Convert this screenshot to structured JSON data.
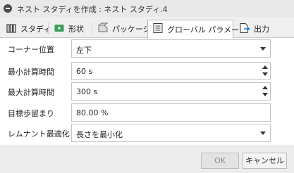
{
  "window": {
    "title": "ネスト スタディを作成 : ネスト スタディ.4"
  },
  "tabs": [
    {
      "label": "スタディ",
      "icon": "study-icon",
      "active": false
    },
    {
      "label": "形状",
      "icon": "shape-icon",
      "active": false
    },
    {
      "label": "パッケージ",
      "icon": "package-icon",
      "active": false
    },
    {
      "label": "グローバル パラメータ",
      "icon": "global-parameters-icon",
      "active": true
    },
    {
      "label": "出力",
      "icon": "output-icon",
      "active": false
    }
  ],
  "form": {
    "corner_position": {
      "label": "コーナー位置",
      "value": "左下"
    },
    "min_calc_time": {
      "label": "最小計算時間",
      "value": "60 s"
    },
    "max_calc_time": {
      "label": "最大計算時間",
      "value": "300 s"
    },
    "target_yield": {
      "label": "目標歩留まり",
      "value": "80.00 %"
    },
    "remnant_optimization": {
      "label": "レムナント最適化",
      "value": "長さを最小化"
    }
  },
  "buttons": {
    "ok": "OK",
    "cancel": "キャンセル"
  },
  "colors": {
    "study_icon": "#3a3a3a",
    "shape_icon": "#3aa05a",
    "package_icon": "#6b6b6b",
    "output_icon": "#2f7fd0"
  }
}
